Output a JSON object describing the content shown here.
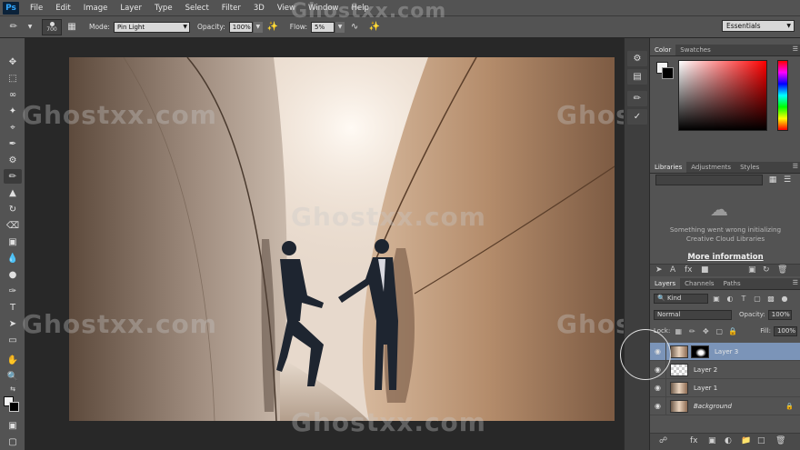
{
  "menubar": {
    "logo": "Ps",
    "items": [
      "File",
      "Edit",
      "Image",
      "Layer",
      "Type",
      "Select",
      "Filter",
      "3D",
      "View",
      "Window",
      "Help"
    ]
  },
  "options": {
    "brush_size": "700",
    "mode_label": "Mode:",
    "mode_value": "Pin Light",
    "opacity_label": "Opacity:",
    "opacity_value": "100%",
    "flow_label": "Flow:",
    "flow_value": "5%",
    "workspace": "Essentials"
  },
  "color_panel": {
    "tabs": [
      "Color",
      "Swatches"
    ]
  },
  "libraries_panel": {
    "tabs": [
      "Libraries",
      "Adjustments",
      "Styles"
    ],
    "message_line1": "Something went wrong initializing",
    "message_line2": "Creative Cloud Libraries",
    "more_info": "More information"
  },
  "layers_panel": {
    "tabs": [
      "Layers",
      "Channels",
      "Paths"
    ],
    "filter_kind": "Kind",
    "blend_mode": "Normal",
    "opacity_label": "Opacity:",
    "opacity_value": "100%",
    "lock_label": "Lock:",
    "fill_label": "Fill:",
    "fill_value": "100%",
    "layers": [
      {
        "name": "Layer 3",
        "selected": true
      },
      {
        "name": "Layer 2",
        "selected": false
      },
      {
        "name": "Layer 1",
        "selected": false
      },
      {
        "name": "Background",
        "selected": false
      }
    ]
  },
  "watermark": "Ghostxx.com"
}
